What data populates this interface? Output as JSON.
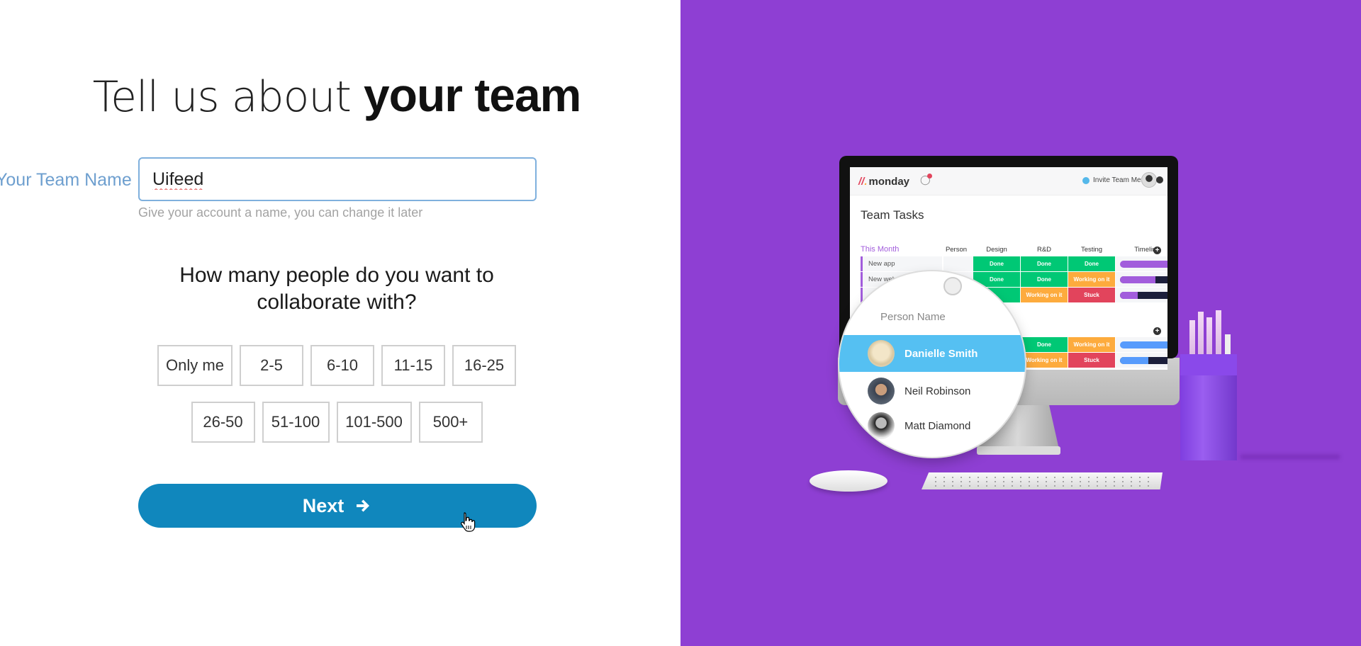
{
  "form": {
    "title_light": "Tell us about ",
    "title_bold": "your team",
    "team_name_label": "Your Team Name",
    "team_name_value": "Uifeed",
    "team_name_hint": "Give your account a name, you can change it later",
    "question": "How many people do you want to collaborate with?",
    "size_options_row1": [
      "Only me",
      "2-5",
      "6-10",
      "11-15",
      "16-25"
    ],
    "size_options_row2": [
      "26-50",
      "51-100",
      "101-500",
      "500+"
    ],
    "next_label": "Next",
    "next_icon": "arrow-right-icon",
    "accent_color": "#1087bd"
  },
  "illustration": {
    "background_color": "#8e3fd3",
    "app": {
      "logo": "monday",
      "invite_label": "Invite Team Members",
      "board_title": "Team Tasks",
      "group_title": "This Month",
      "columns": [
        "Person",
        "Design",
        "R&D",
        "Testing",
        "Timeline"
      ],
      "rows": [
        {
          "name": "New app",
          "design": "Done",
          "rnd": "Done",
          "testing": "Done",
          "timeline": 1.0
        },
        {
          "name": "New web",
          "design": "Done",
          "rnd": "Done",
          "testing": "Working on it",
          "timeline": 0.7
        },
        {
          "name": "",
          "design": "",
          "rnd": "Working on it",
          "testing": "Stuck",
          "timeline": 0.35
        }
      ],
      "rows_group2": [
        {
          "rnd": "Done",
          "testing": "Working on it",
          "timeline": 1.0
        },
        {
          "rnd": "Working on it",
          "testing": "Stuck",
          "timeline": 0.55
        }
      ],
      "status_colors": {
        "Done": "#00c875",
        "Working on it": "#fdab3d",
        "Stuck": "#e2445c"
      }
    },
    "person_picker": {
      "header": "Person Name",
      "people": [
        "Danielle Smith",
        "Neil Robinson",
        "Matt Diamond"
      ],
      "selected": "Danielle Smith"
    }
  }
}
